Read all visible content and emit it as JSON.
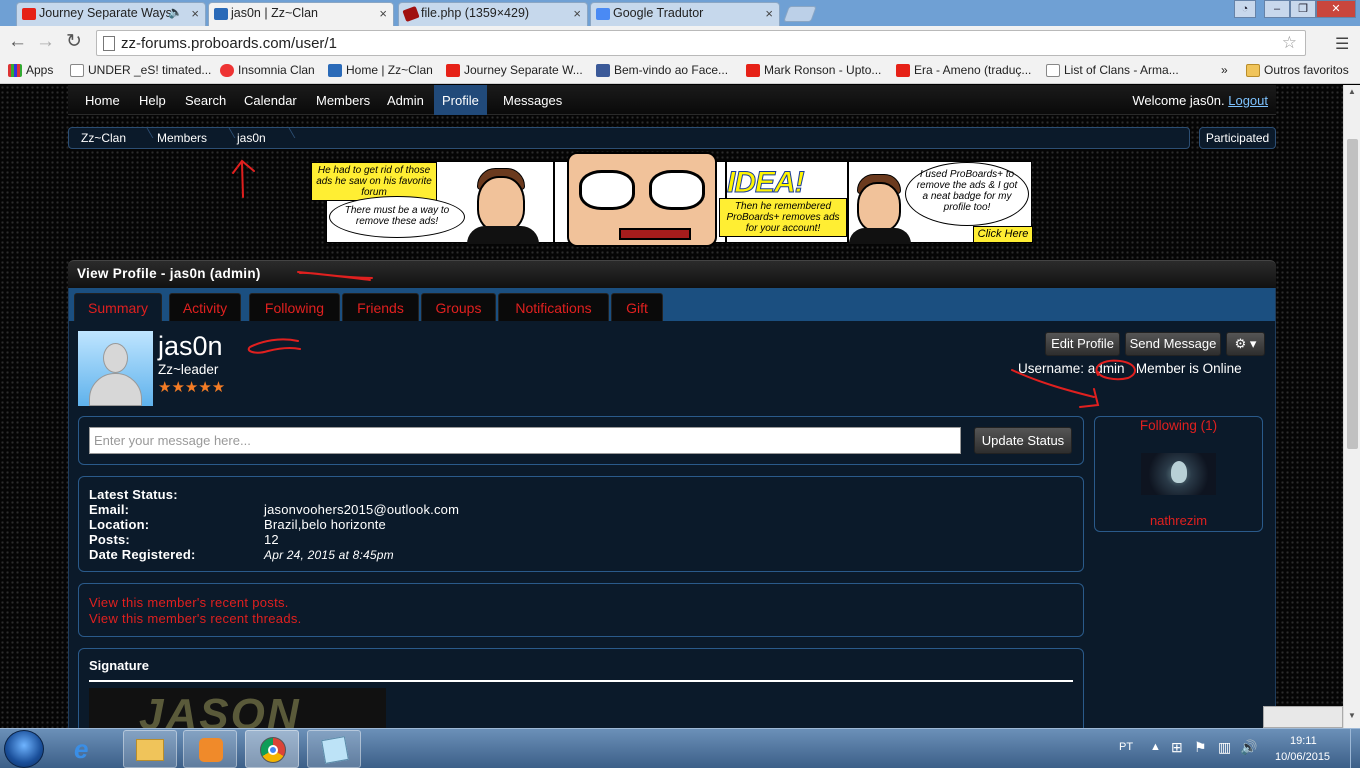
{
  "browser": {
    "tabs": [
      {
        "title": "Journey Separate Ways",
        "active": false,
        "icon": "youtube-icon"
      },
      {
        "title": "jas0n | Zz~Clan",
        "active": true,
        "icon": "proboards-icon"
      },
      {
        "title": "file.php (1359×429)",
        "active": false,
        "icon": "image-icon"
      },
      {
        "title": "Google Tradutor",
        "active": false,
        "icon": "translate-icon"
      }
    ],
    "close_glyph": "×",
    "url": "zz-forums.proboards.com/user/1",
    "bookmarks": [
      {
        "label": "Apps",
        "icon": "apps-grid-icon"
      },
      {
        "label": "UNDER _eS! timated...",
        "icon": "page-icon"
      },
      {
        "label": "Insomnia Clan",
        "icon": "pill-icon"
      },
      {
        "label": "Home | Zz~Clan",
        "icon": "proboards-icon"
      },
      {
        "label": "Journey Separate W...",
        "icon": "youtube-icon"
      },
      {
        "label": "Bem-vindo ao Face...",
        "icon": "facebook-icon"
      },
      {
        "label": "Mark Ronson - Upto...",
        "icon": "youtube-icon"
      },
      {
        "label": "Era - Ameno (traduç...",
        "icon": "youtube-icon"
      },
      {
        "label": "List of Clans - Arma...",
        "icon": "page-icon"
      }
    ],
    "bookmarks_overflow": "»",
    "other_bookmarks": "Outros favoritos"
  },
  "forum": {
    "nav": [
      "Home",
      "Help",
      "Search",
      "Calendar",
      "Members",
      "Admin",
      "Profile",
      "Messages"
    ],
    "active_nav": "Profile",
    "welcome_prefix": "Welcome jas0n.",
    "logout": "Logout",
    "breadcrumbs": [
      "Zz~Clan",
      "Members",
      "jas0n"
    ],
    "participated": "Participated"
  },
  "ad": {
    "panel1_box": "He had to get rid of those ads he saw on his favorite forum",
    "panel1_bubble": "There must be a way to remove these ads!",
    "idea": "IDEA!",
    "panel3_box": "Then he remembered ProBoards+ removes ads for your account!",
    "panel4_bubble": "I used ProBoards+ to remove the ads & I got a neat badge for my profile too!",
    "cta": "Click Here"
  },
  "profile": {
    "header": "View Profile - jas0n (admin)",
    "tabs": [
      "Summary",
      "Activity",
      "Following",
      "Friends",
      "Groups",
      "Notifications",
      "Gift"
    ],
    "active_tab": "Summary",
    "display_name": "jas0n",
    "rank": "Zz~leader",
    "stars": "★★★★★",
    "buttons": {
      "edit": "Edit Profile",
      "send": "Send Message",
      "gear": "⚙ ▾"
    },
    "username_label": "Username:",
    "username": "admin",
    "online": "Member is Online",
    "status_placeholder": "Enter your message here...",
    "update_status": "Update Status",
    "details": [
      {
        "label": "Latest Status:",
        "value": ""
      },
      {
        "label": "Email:",
        "value": "jasonvoohers2015@outlook.com"
      },
      {
        "label": "Location:",
        "value": "Brazil,belo horizonte"
      },
      {
        "label": "Posts:",
        "value": "12"
      },
      {
        "label": "Date Registered:",
        "value": "Apr 24, 2015 at 8:45pm"
      }
    ],
    "recent_posts": "View this member's recent posts.",
    "recent_threads": "View this member's recent threads.",
    "signature_title": "Signature",
    "signature_text": "JASON",
    "following_title": "Following (1)",
    "following_name": "nathrezim"
  },
  "taskbar": {
    "lang": "PT",
    "time": "19:11",
    "date": "10/06/2015"
  }
}
